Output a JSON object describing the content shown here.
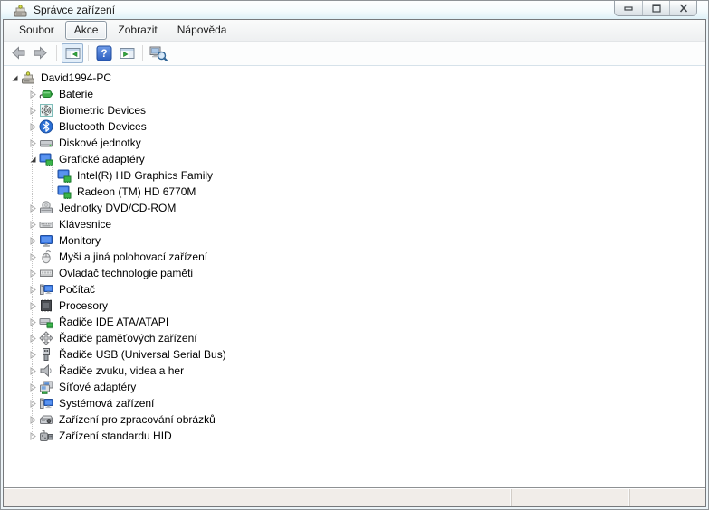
{
  "window": {
    "title": "Správce zařízení"
  },
  "titlebar": {
    "controls": [
      {
        "id": "minimize",
        "icon": "minimize-icon"
      },
      {
        "id": "maximize",
        "icon": "maximize-icon"
      },
      {
        "id": "close",
        "icon": "close-icon"
      }
    ]
  },
  "menu": {
    "items": [
      {
        "id": "soubor",
        "label": "Soubor",
        "focused": false
      },
      {
        "id": "akce",
        "label": "Akce",
        "focused": true
      },
      {
        "id": "zobrazit",
        "label": "Zobrazit",
        "focused": false
      },
      {
        "id": "napoveda",
        "label": "Nápověda",
        "focused": false
      }
    ]
  },
  "toolbar": {
    "buttons": [
      {
        "id": "back",
        "icon": "back-arrow-icon"
      },
      {
        "id": "forward",
        "icon": "forward-arrow-icon"
      },
      {
        "separator": true
      },
      {
        "id": "show-console-tree",
        "icon": "console-tree-icon",
        "pressed": true
      },
      {
        "separator": true
      },
      {
        "id": "help",
        "icon": "help-icon"
      },
      {
        "id": "show-action-pane",
        "icon": "action-pane-icon"
      },
      {
        "separator": true
      },
      {
        "id": "scan-hardware",
        "icon": "scan-hardware-icon"
      }
    ]
  },
  "tree": {
    "items": [
      {
        "label": "David1994-PC",
        "icon": "device-manager-computer-icon",
        "level": 0,
        "state": "expanded"
      },
      {
        "label": "Baterie",
        "icon": "battery-icon",
        "level": 1,
        "state": "collapsed"
      },
      {
        "label": "Biometric Devices",
        "icon": "fingerprint-icon",
        "level": 1,
        "state": "collapsed"
      },
      {
        "label": "Bluetooth Devices",
        "icon": "bluetooth-icon",
        "level": 1,
        "state": "collapsed"
      },
      {
        "label": "Diskové jednotky",
        "icon": "disk-drive-icon",
        "level": 1,
        "state": "collapsed"
      },
      {
        "label": "Grafické adaptéry",
        "icon": "display-adapter-icon",
        "level": 1,
        "state": "expanded"
      },
      {
        "label": "Intel(R) HD Graphics Family",
        "icon": "display-adapter-icon",
        "level": 2,
        "state": "none"
      },
      {
        "label": "Radeon (TM) HD 6770M",
        "icon": "display-adapter-icon",
        "level": 2,
        "state": "none"
      },
      {
        "label": "Jednotky DVD/CD-ROM",
        "icon": "dvd-drive-icon",
        "level": 1,
        "state": "collapsed"
      },
      {
        "label": "Klávesnice",
        "icon": "keyboard-icon",
        "level": 1,
        "state": "collapsed"
      },
      {
        "label": "Monitory",
        "icon": "monitor-icon",
        "level": 1,
        "state": "collapsed"
      },
      {
        "label": "Myši a jiná polohovací zařízení",
        "icon": "mouse-icon",
        "level": 1,
        "state": "collapsed"
      },
      {
        "label": "Ovladač technologie paměti",
        "icon": "memory-controller-icon",
        "level": 1,
        "state": "collapsed"
      },
      {
        "label": "Počítač",
        "icon": "computer-icon",
        "level": 1,
        "state": "collapsed"
      },
      {
        "label": "Procesory",
        "icon": "processor-icon",
        "level": 1,
        "state": "collapsed"
      },
      {
        "label": "Řadiče IDE ATA/ATAPI",
        "icon": "ide-controller-icon",
        "level": 1,
        "state": "collapsed"
      },
      {
        "label": "Řadiče paměťových zařízení",
        "icon": "storage-controller-icon",
        "level": 1,
        "state": "collapsed"
      },
      {
        "label": "Řadiče USB (Universal Serial Bus)",
        "icon": "usb-icon",
        "level": 1,
        "state": "collapsed"
      },
      {
        "label": "Řadiče zvuku, videa a her",
        "icon": "audio-icon",
        "level": 1,
        "state": "collapsed"
      },
      {
        "label": "Síťové adaptéry",
        "icon": "network-adapter-icon",
        "level": 1,
        "state": "collapsed"
      },
      {
        "label": "Systémová zařízení",
        "icon": "system-device-icon",
        "level": 1,
        "state": "collapsed"
      },
      {
        "label": "Zařízení pro zpracování obrázků",
        "icon": "imaging-device-icon",
        "level": 1,
        "state": "collapsed"
      },
      {
        "label": "Zařízení standardu HID",
        "icon": "hid-icon",
        "level": 1,
        "state": "collapsed"
      }
    ]
  },
  "statusbar": {
    "segments": [
      "",
      "",
      ""
    ]
  },
  "colors": {
    "help_icon_blue": "#3c66c0",
    "bluetooth_blue": "#2b6fd4",
    "monitor_blue": "#2f6fe0",
    "battery_green": "#3fae49",
    "chip_green": "#3bb54a",
    "pressed_toolbar_border": "#98b4d2",
    "statusbar_bg": "#f1ede9",
    "titlebar_tint": "#dff1f8"
  }
}
